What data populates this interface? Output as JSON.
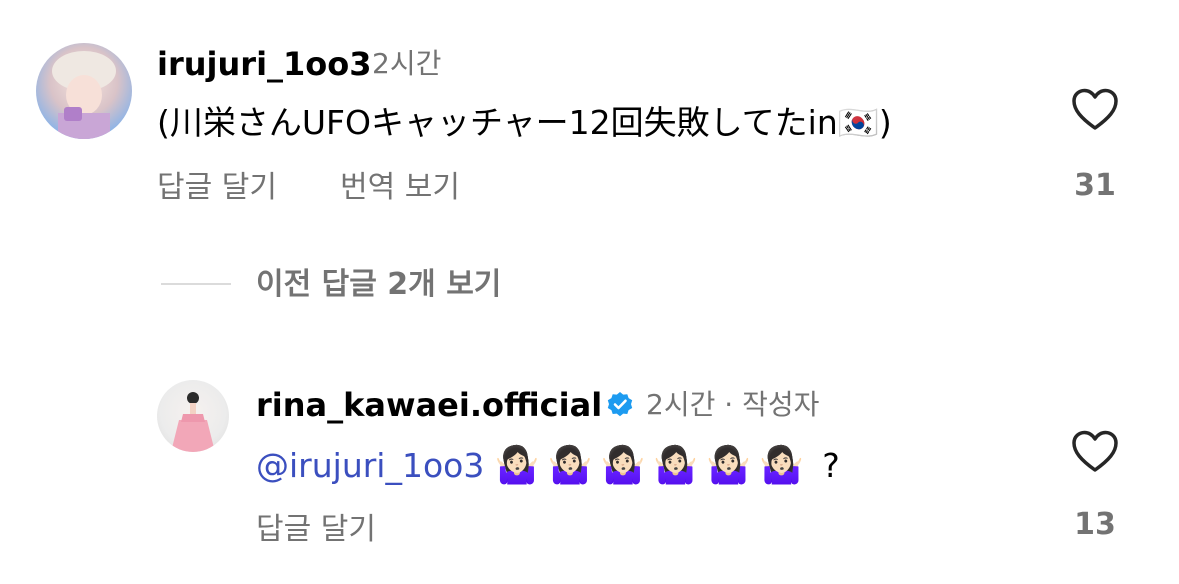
{
  "comment": {
    "username": "irujuri_1oo3",
    "time": "2시간",
    "text": "(川栄さんUFOキャッチャー12回失敗してたin",
    "flag": "🇰🇷",
    "closing": ")",
    "reply_label": "답글 달기",
    "translate_label": "번역 보기",
    "like_count": "31"
  },
  "view_replies_label": "이전 답글 2개 보기",
  "reply": {
    "username": "rina_kawaei.official",
    "time": "2시간",
    "separator": "·",
    "author_badge": "작성자",
    "mention": "@irujuri_1oo3",
    "emojis": "🤷🏻‍♀️🤷🏻‍♀️🤷🏻‍♀️🤷🏻‍♀️🤷🏻‍♀️🤷🏻‍♀️",
    "trailing": "?",
    "reply_label": "답글 달기",
    "like_count": "13"
  },
  "colors": {
    "verified": "#1d9bf0",
    "muted": "#737373",
    "mention": "#3b4fbf"
  },
  "icons": {
    "like": "heart-outline-icon",
    "verified": "verified-badge-icon"
  }
}
